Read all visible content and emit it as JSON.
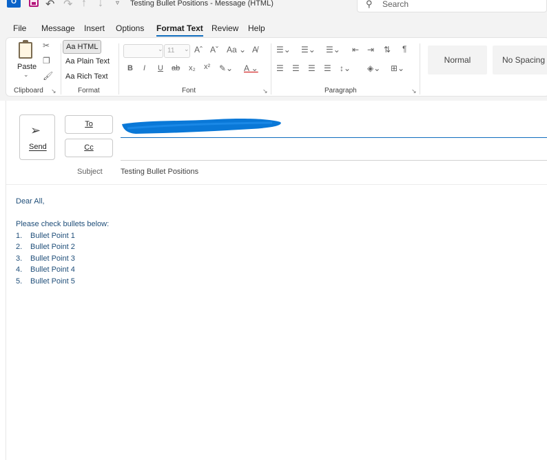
{
  "window": {
    "title": "Testing Bullet Positions  -  Message (HTML)",
    "search_placeholder": "Search"
  },
  "menu": {
    "tabs": [
      {
        "label": "File"
      },
      {
        "label": "Message"
      },
      {
        "label": "Insert"
      },
      {
        "label": "Options"
      },
      {
        "label": "Format Text"
      },
      {
        "label": "Review"
      },
      {
        "label": "Help"
      }
    ],
    "active_tab": "Format Text"
  },
  "ribbon": {
    "clipboard": {
      "paste_label": "Paste",
      "group_label": "Clipboard"
    },
    "format": {
      "html_label": "Aa HTML",
      "plain_label": "Aa Plain Text",
      "rich_label": "Aa Rich Text",
      "group_label": "Format"
    },
    "font": {
      "font_size": "11",
      "group_label": "Font"
    },
    "paragraph": {
      "group_label": "Paragraph"
    },
    "styles": {
      "normal_label": "Normal",
      "no_spacing_label": "No Spacing"
    }
  },
  "compose": {
    "send_label": "Send",
    "to_label": "To",
    "cc_label": "Cc",
    "subject_label": "Subject",
    "subject_value": "Testing Bullet Positions"
  },
  "body": {
    "greeting": "Dear All,",
    "intro": "Please check bullets below:",
    "bullets": [
      {
        "num": "1.",
        "text": "Bullet Point 1"
      },
      {
        "num": "2.",
        "text": "Bullet Point 2"
      },
      {
        "num": "3.",
        "text": "Bullet Point 3"
      },
      {
        "num": "4.",
        "text": "Bullet Point 4"
      },
      {
        "num": "5.",
        "text": "Bullet Point 5"
      }
    ]
  },
  "colors": {
    "accent": "#0f6cbd",
    "body_text": "#1f4e79",
    "redaction": "#0a78d7"
  }
}
